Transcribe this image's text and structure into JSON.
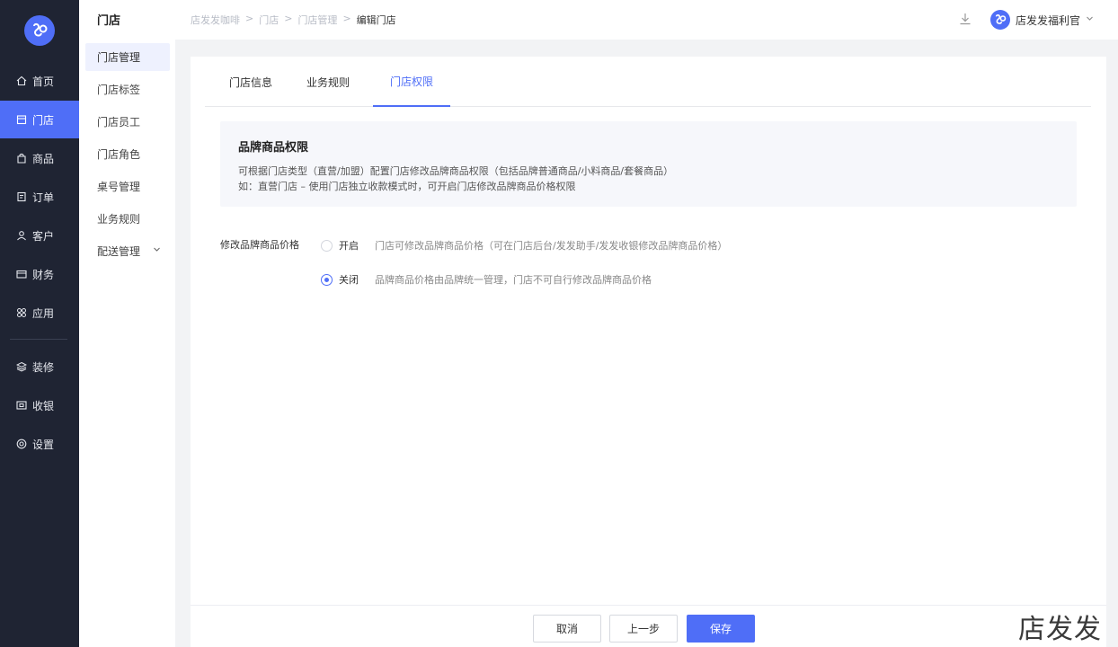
{
  "nav": {
    "items": [
      {
        "label": "首页",
        "icon": "home-icon"
      },
      {
        "label": "门店",
        "icon": "store-icon"
      },
      {
        "label": "商品",
        "icon": "bag-icon"
      },
      {
        "label": "订单",
        "icon": "order-icon"
      },
      {
        "label": "客户",
        "icon": "user-icon"
      },
      {
        "label": "财务",
        "icon": "wallet-icon"
      },
      {
        "label": "应用",
        "icon": "apps-icon"
      },
      {
        "label": "装修",
        "icon": "layers-icon"
      },
      {
        "label": "收银",
        "icon": "cashier-icon"
      },
      {
        "label": "设置",
        "icon": "settings-icon"
      }
    ],
    "active_index": 1
  },
  "submenu": {
    "title": "门店",
    "items": [
      {
        "label": "门店管理"
      },
      {
        "label": "门店标签"
      },
      {
        "label": "门店员工"
      },
      {
        "label": "门店角色"
      },
      {
        "label": "桌号管理"
      },
      {
        "label": "业务规则"
      },
      {
        "label": "配送管理"
      }
    ]
  },
  "header": {
    "breadcrumb": [
      "店发发咖啡",
      "门店",
      "门店管理",
      "编辑门店"
    ],
    "breadcrumb_sep": ">",
    "user_name": "店发发福利官"
  },
  "tabs": [
    {
      "label": "门店信息"
    },
    {
      "label": "业务规则"
    },
    {
      "label": "门店权限"
    }
  ],
  "info": {
    "title": "品牌商品权限",
    "line1": "可根据门店类型（直营/加盟）配置门店修改品牌商品权限（包括品牌普通商品/小料商品/套餐商品）",
    "line2": "如：直营门店 – 使用门店独立收款模式时，可开启门店修改品牌商品价格权限"
  },
  "form": {
    "label": "修改品牌商品价格",
    "options": [
      {
        "label": "开启",
        "desc": "门店可修改品牌商品价格（可在门店后台/发发助手/发发收银修改品牌商品价格）",
        "checked": false
      },
      {
        "label": "关闭",
        "desc": "品牌商品价格由品牌统一管理，门店不可自行修改品牌商品价格",
        "checked": true
      }
    ]
  },
  "footer": {
    "cancel": "取消",
    "prev": "上一步",
    "save": "保存"
  },
  "watermark": "店发发",
  "colors": {
    "accent": "#4f6ef7",
    "nav_bg": "#1f2433"
  }
}
